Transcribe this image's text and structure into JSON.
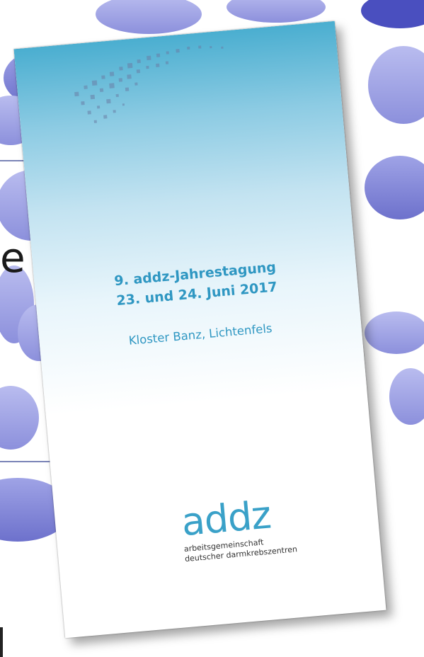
{
  "background": {
    "fragment_text": "e",
    "accent_color": "#7b7fd4"
  },
  "flyer": {
    "title": "9. addz-Jahrestagung",
    "date": "23. und 24. Juni 2017",
    "location": "Kloster Banz, Lichtenfels",
    "logo_word": "addz",
    "logo_line1": "arbeitsgemeinschaft",
    "logo_line2": "deutscher darmkrebszentren",
    "text_color": "#2f97c2",
    "gradient_color": "#4aaed0"
  }
}
